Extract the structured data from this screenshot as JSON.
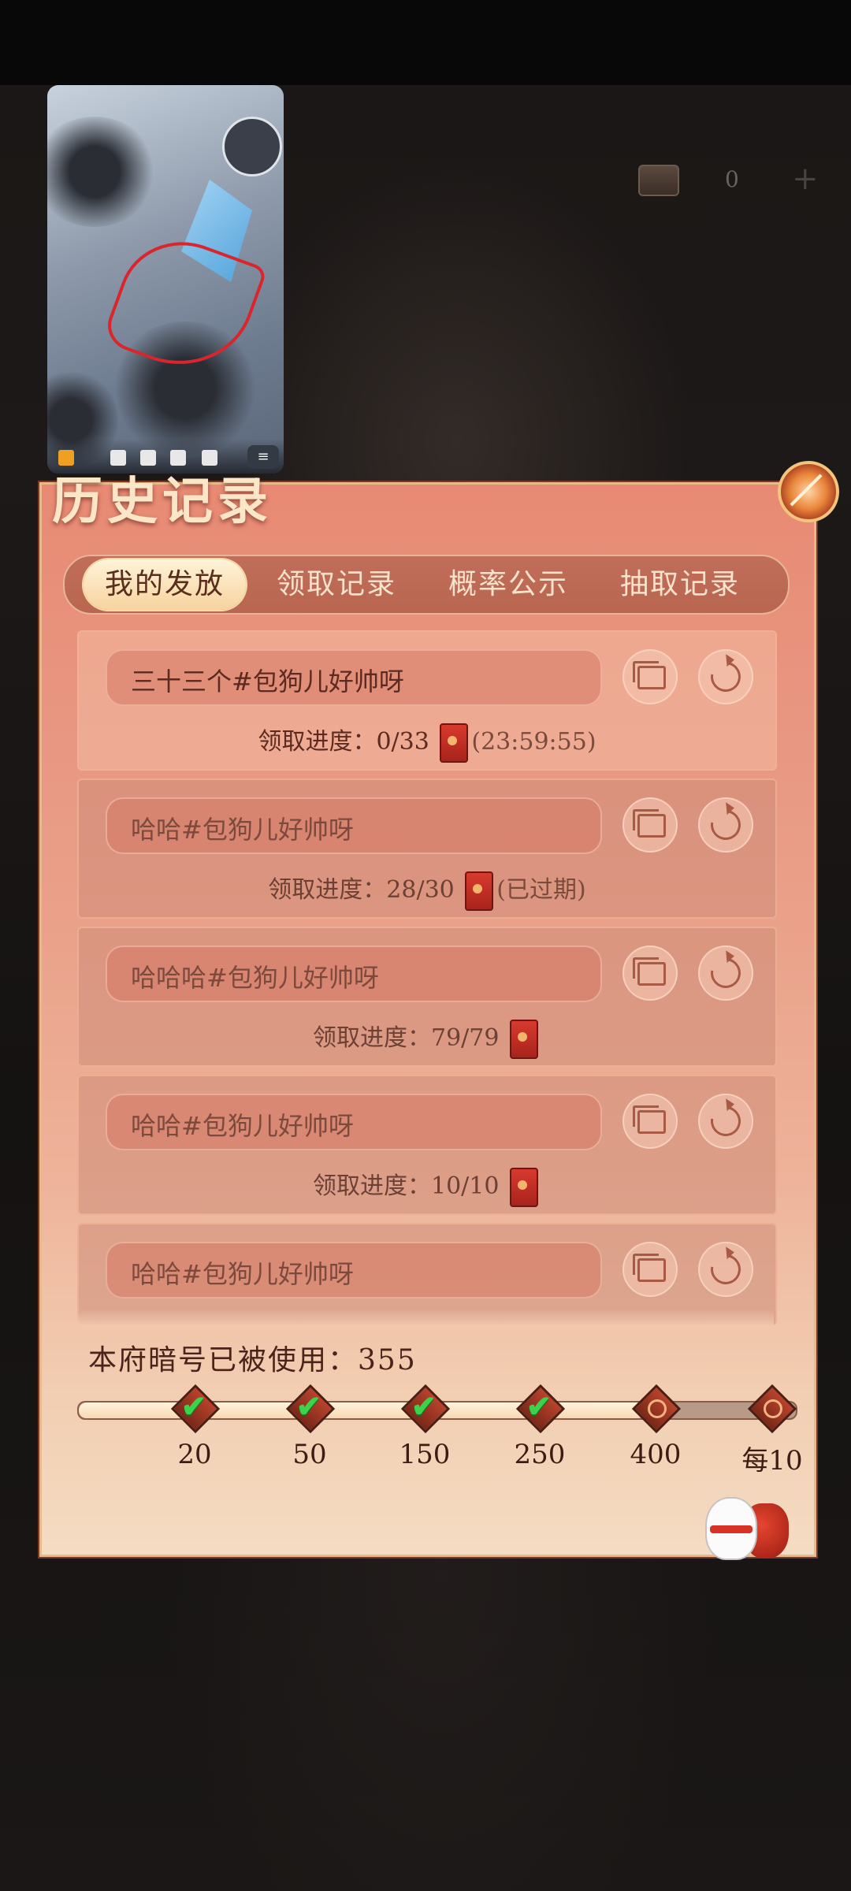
{
  "top": {
    "coin_count": "0",
    "plus": "+"
  },
  "panel": {
    "title": "历史记录",
    "tabs": [
      "我的发放",
      "领取记录",
      "概率公示",
      "抽取记录"
    ]
  },
  "records": [
    {
      "message": "三十三个#包狗儿好帅呀",
      "progress_label": "领取进度：",
      "progress": "0/33",
      "tail": "(23:59:55)"
    },
    {
      "message": "哈哈#包狗儿好帅呀",
      "progress_label": "领取进度：",
      "progress": "28/30",
      "tail": "(已过期)"
    },
    {
      "message": "哈哈哈#包狗儿好帅呀",
      "progress_label": "领取进度：",
      "progress": "79/79",
      "tail": ""
    },
    {
      "message": "哈哈#包狗儿好帅呀",
      "progress_label": "领取进度：",
      "progress": "10/10",
      "tail": ""
    },
    {
      "message": "哈哈#包狗儿好帅呀",
      "progress_label": "",
      "progress": "",
      "tail": ""
    }
  ],
  "usage": {
    "label": "本府暗号已被使用：",
    "count": "355",
    "filled_fraction": 0.79,
    "milestones": [
      {
        "label": "20",
        "claimed": true
      },
      {
        "label": "50",
        "claimed": true
      },
      {
        "label": "150",
        "claimed": true
      },
      {
        "label": "250",
        "claimed": true
      },
      {
        "label": "400",
        "claimed": false
      },
      {
        "label": "每10",
        "claimed": false
      }
    ]
  },
  "icons": {
    "copy": "copy-icon",
    "share": "share-icon",
    "envelope": "red-envelope-icon",
    "check": "checkmark-icon",
    "reward": "reward-bag-icon"
  },
  "colors": {
    "panel_top": "#e88a73",
    "panel_bottom": "#f4dcc2",
    "active_tab": "#f7d39f",
    "check": "#3cd24a"
  }
}
